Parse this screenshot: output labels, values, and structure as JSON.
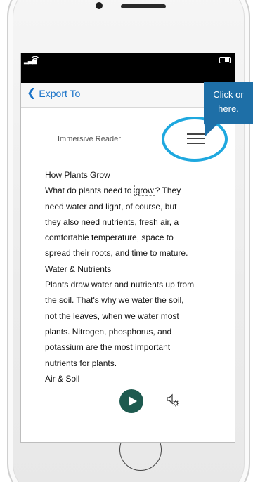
{
  "nav": {
    "back_label": "Export To"
  },
  "reader": {
    "title": "Immersive Reader",
    "lines": [
      "How Plants Grow",
      "What do plants need to ",
      "grow",
      "? They",
      "need water and light, of course, but",
      "they also need nutrients, fresh air, a",
      "comfortable temperature, space to",
      "spread their roots, and time to mature.",
      "Water & Nutrients",
      "Plants draw water and nutrients up from",
      "the soil. That's why we water the soil,",
      "not the leaves, when we water most",
      "plants. Nitrogen, phosphorus, and",
      "potassium are the most important",
      "nutrients for plants.",
      "Air & Soil"
    ]
  },
  "callout": {
    "line1": "Click or",
    "line2": "here."
  },
  "icons": {
    "back": "chevron-left-icon",
    "menu": "hamburger-menu-icon",
    "play": "play-icon",
    "voice_settings": "voice-settings-icon"
  },
  "colors": {
    "accent": "#1a73c8",
    "play_button": "#1e5a4f",
    "callout": "#1e6fa7",
    "callout_ring": "#1ea8df"
  }
}
